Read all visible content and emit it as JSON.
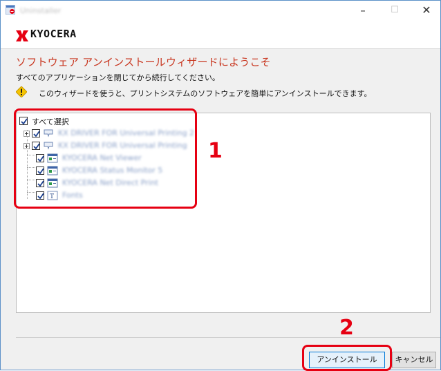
{
  "window": {
    "title": "Uninstaller",
    "minimize_glyph": "–",
    "maximize_glyph": "☐",
    "close_glyph": "✕"
  },
  "brand": {
    "logo_text": "KYOCERA",
    "logo_color": "#e60012"
  },
  "wizard": {
    "heading": "ソフトウェア アンインストールウィザードにようこそ",
    "close_apps_notice": "すべてのアプリケーションを閉じてから続行してください。",
    "info_text": "このウィザードを使うと、プリントシステムのソフトウェアを簡単にアンインストールできます。"
  },
  "tree": {
    "select_all": {
      "label": "すべて選択",
      "checked": true
    },
    "items": [
      {
        "label": "KX DRIVER FOR Universal Printing 2",
        "icon": "printer-icon",
        "expandable": true,
        "checked": true
      },
      {
        "label": "KX DRIVER FOR Universal Printing",
        "icon": "printer-icon",
        "expandable": true,
        "checked": true
      },
      {
        "label": "KYOCERA Net Viewer",
        "icon": "application-icon",
        "expandable": false,
        "checked": true
      },
      {
        "label": "KYOCERA Status Monitor 5",
        "icon": "application-icon",
        "expandable": false,
        "checked": true
      },
      {
        "label": "KYOCERA Net Direct Print",
        "icon": "application-icon",
        "expandable": false,
        "checked": true
      },
      {
        "label": "Fonts",
        "icon": "font-icon",
        "expandable": false,
        "checked": true
      }
    ]
  },
  "callouts": {
    "tree_number": "1",
    "install_number": "2",
    "color": "#e60012"
  },
  "buttons": {
    "install": "アンインストール",
    "cancel": "キャンセル"
  }
}
